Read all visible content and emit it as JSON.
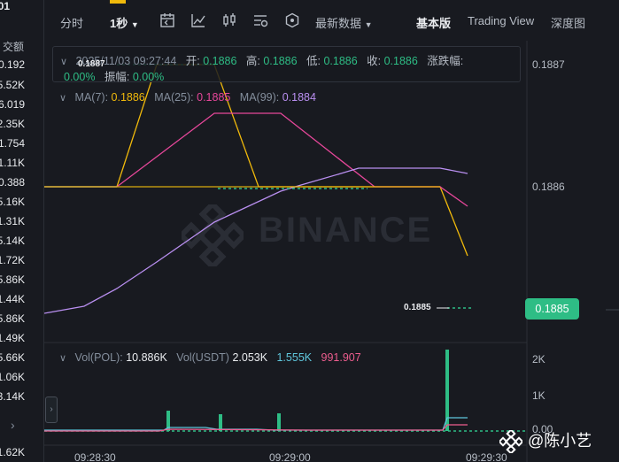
{
  "left_column": {
    "header_fragment": "01",
    "header_label": "交额",
    "values": [
      "0.192",
      "5.52K",
      "6.019",
      "2.35K",
      "1.754",
      "1.11K",
      "0.388",
      "5.16K",
      "1.31K",
      "5.14K",
      "1.72K",
      "5.86K",
      "1.44K",
      "5.86K",
      "1.49K",
      "5.66K",
      "1.06K",
      "3.14K",
      "",
      "1.62K"
    ],
    "arrow": "›"
  },
  "toolbar": {
    "time_label": "分时",
    "interval_label": "1秒",
    "latest_data_label": "最新数据",
    "basic_label": "基本版",
    "tradingview_label": "Trading View",
    "depth_label": "深度图"
  },
  "info": {
    "datetime": "2025/11/03 09:27:44",
    "open_label": "开:",
    "open": "0.1886",
    "high_label": "高:",
    "high": "0.1886",
    "low_label": "低:",
    "low": "0.1886",
    "close_label": "收:",
    "close": "0.1886",
    "change_label": "涨跌幅:",
    "change": "0.00%",
    "amplitude_label": "振幅:",
    "amplitude": "0.00%"
  },
  "ma": {
    "ma7_label": "MA(7):",
    "ma7": "0.1886",
    "ma25_label": "MA(25):",
    "ma25": "0.1885",
    "ma99_label": "MA(99):",
    "ma99": "0.1884"
  },
  "volume": {
    "pol_label": "Vol(POL):",
    "pol": "10.886K",
    "usdt_label": "Vol(USDT)",
    "usdt1": "2.053K",
    "usdt2": "1.555K",
    "usdt3": "991.907"
  },
  "price_axis": {
    "top": "0.1887",
    "mid": "0.1886",
    "current": "0.1885",
    "high_marker": "0.1887",
    "low_marker": "0.1885"
  },
  "volume_axis": {
    "v2k": "2K",
    "v1k": "1K",
    "v0": "0.00"
  },
  "time_axis": [
    "09:28:30",
    "09:29:00",
    "09:29:30"
  ],
  "watermark": "BINANCE",
  "author": "@陈小艺",
  "colors": {
    "background": "#181a20",
    "green": "#2ebd85",
    "yellow": "#f0b90b",
    "pink": "#e6479a",
    "purple": "#b98ff0",
    "cyan": "#5fc6dc"
  }
}
